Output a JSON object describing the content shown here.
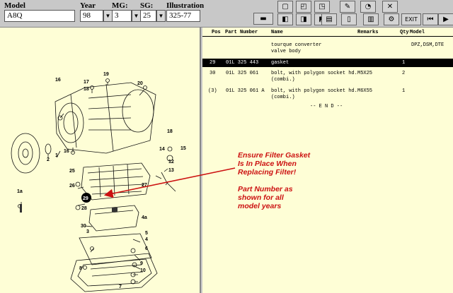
{
  "fields": {
    "model": {
      "label": "Model",
      "value": "A8Q"
    },
    "year": {
      "label": "Year",
      "value": "98"
    },
    "mg": {
      "label": "MG:",
      "value": "3"
    },
    "sg": {
      "label": "SG:",
      "value": "25"
    },
    "illustration": {
      "label": "Illustration",
      "value": "325-77"
    }
  },
  "toolbar": {
    "exit_label": "EXIT"
  },
  "diagram": {
    "callouts": [
      "16",
      "17",
      "18",
      "19",
      "20",
      "2",
      "1",
      "16",
      "18",
      "14",
      "15",
      "12",
      "13",
      "25",
      "26",
      "27",
      "1a",
      "29",
      "28",
      "4a",
      "30",
      "3",
      "5",
      "4",
      "6",
      "8",
      "9",
      "10",
      "7"
    ]
  },
  "table": {
    "headers": {
      "pos": "Pos",
      "part_number": "Part Number",
      "name": "Name",
      "remarks": "Remarks",
      "qty": "Qty",
      "model": "Model"
    },
    "group": {
      "line1": "tourque converter",
      "line2": "valve body",
      "model": "DPZ,DSM,DTE"
    },
    "rows": [
      {
        "pos": "29",
        "part_number": "01L 325 443",
        "name": "gasket",
        "name2": "",
        "remarks": "",
        "qty": "1",
        "selected": true
      },
      {
        "pos": "30",
        "part_number": "01L 325 061",
        "name": "bolt, with polygon socket hd.",
        "name2": "(combi.)",
        "remarks": "M5X25",
        "qty": "2",
        "selected": false
      },
      {
        "pos": "(3)",
        "part_number": "01L 325 061 A",
        "name": "bolt, with polygon socket hd.",
        "name2": "(combi.)",
        "remarks": "M6X55",
        "qty": "1",
        "selected": false
      }
    ],
    "end_text": "-- E N D --"
  },
  "annotation": {
    "line1": "Ensure Filter Gasket",
    "line2": "Is In Place When",
    "line3": "Replacing Filter!",
    "line4": "Part Number as",
    "line5": "shown for all",
    "line6": "model years"
  }
}
